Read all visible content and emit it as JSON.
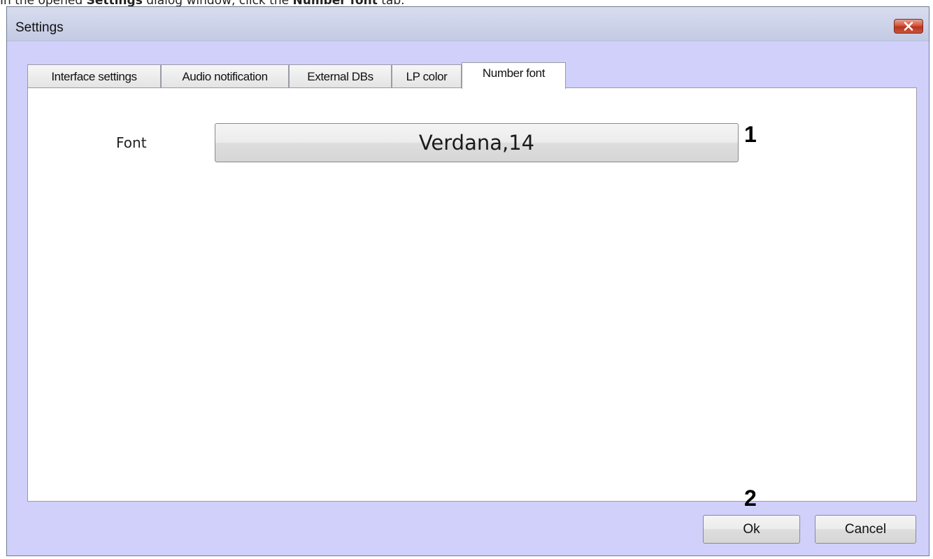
{
  "caption": {
    "pre": "In the opened ",
    "bold1": "Settings",
    "mid": " dialog window, click the ",
    "bold2": "Number font",
    "post": " tab."
  },
  "window": {
    "title": "Settings",
    "close_icon": "close-x-icon"
  },
  "tabs": [
    {
      "label": "Interface settings",
      "active": false
    },
    {
      "label": "Audio notification",
      "active": false
    },
    {
      "label": "External DBs",
      "active": false
    },
    {
      "label": "LP color",
      "active": false
    },
    {
      "label": "Number font",
      "active": true
    }
  ],
  "panel": {
    "font_label": "Font",
    "font_value": "Verdana,14"
  },
  "callouts": {
    "one": "1",
    "two": "2"
  },
  "buttons": {
    "ok": "Ok",
    "cancel": "Cancel"
  },
  "colors": {
    "window_background": "#d0d0fa",
    "close_button": "#c9553c"
  }
}
